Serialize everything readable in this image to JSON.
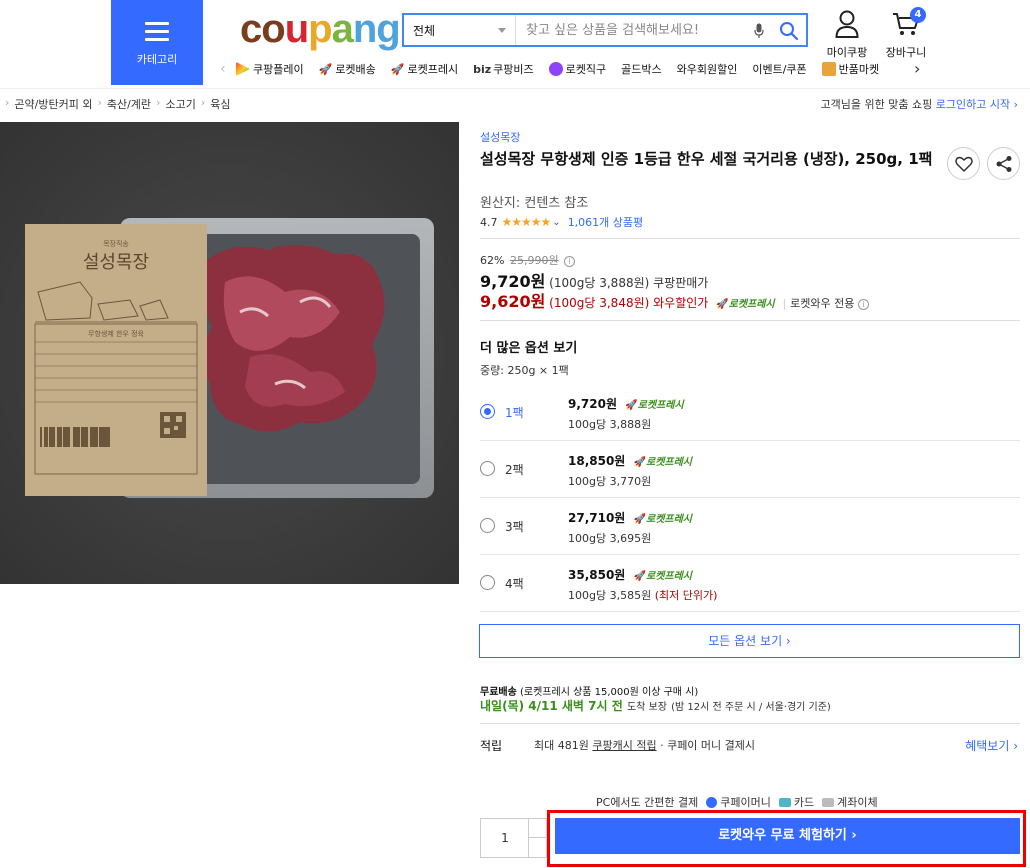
{
  "header": {
    "category_label": "카테고리",
    "logo": [
      "c",
      "o",
      "u",
      "p",
      "a",
      "n",
      "g"
    ],
    "search": {
      "scope": "전체",
      "placeholder": "찾고 싶은 상품을 검색해보세요!"
    },
    "mycoupang_label": "마이쿠팡",
    "cart_label": "장바구니",
    "cart_count": "4"
  },
  "subnav": [
    {
      "label": "쿠팡플레이",
      "icon": "play-icon"
    },
    {
      "label": "로켓배송",
      "icon": "rocket-icon"
    },
    {
      "label": "로켓프레시",
      "icon": "rocket-fresh-icon"
    },
    {
      "prefix": "biz",
      "label": "쿠팡비즈",
      "icon": "biz-icon"
    },
    {
      "label": "로켓직구",
      "icon": "global-icon"
    },
    {
      "label": "골드박스",
      "icon": ""
    },
    {
      "label": "와우회원할인",
      "icon": ""
    },
    {
      "label": "이벤트/쿠폰",
      "icon": ""
    },
    {
      "label": "반품마켓",
      "icon": "return-icon"
    }
  ],
  "breadcrumb": [
    "곤약/방탄커피 외",
    "축산/계란",
    "소고기",
    "육심"
  ],
  "tailored": {
    "text": "고객님을 위한 맞춤 쇼핑",
    "link": "로그인하고 시작 ›"
  },
  "product": {
    "brand": "설성목장",
    "title": "설성목장 무항생제 인증 1등급 한우 세절 국거리용 (냉장), 250g, 1팩",
    "origin": "원산지: 컨텐츠 참조",
    "rating": "4.7",
    "stars": "★★★★★",
    "review_count": "1,061개 상품평",
    "discount_rate": "62%",
    "original_price": "25,990원",
    "price": "9,720원",
    "price_unit": "(100g당 3,888원)",
    "price_label": "쿠팡판매가",
    "wow_price": "9,620원",
    "wow_unit": "(100g당 3,848원)",
    "wow_label": "와우할인가",
    "rocket_fresh": "로켓프레시",
    "wow_only": "로켓와우 전용"
  },
  "options": {
    "heading": "더 많은 옵션 보기",
    "weight": "중량: 250g × 1팩",
    "items": [
      {
        "qty": "1팩",
        "price": "9,720원",
        "unit": "100g당 3,888원",
        "note": "",
        "selected": true
      },
      {
        "qty": "2팩",
        "price": "18,850원",
        "unit": "100g당 3,770원",
        "note": "",
        "selected": false
      },
      {
        "qty": "3팩",
        "price": "27,710원",
        "unit": "100g당 3,695원",
        "note": "",
        "selected": false
      },
      {
        "qty": "4팩",
        "price": "35,850원",
        "unit": "100g당 3,585원",
        "note": "(최저 단위가)",
        "selected": false
      }
    ],
    "all_options": "모든 옵션 보기 ›"
  },
  "shipping": {
    "free_label": "무료배송",
    "free_cond": "(로켓프레시 상품 15,000원 이상 구매 시)",
    "arrival": "내일(목) 4/11 새벽 7시 전",
    "arrival_note": "도착 보장",
    "arrival_cond": "(밤 12시 전 주문 시 / 서울·경기 기준)"
  },
  "points": {
    "label": "적립",
    "prefix": "최대 481원",
    "link": "쿠팡캐시 적립",
    "suffix": " · 쿠페이 머니 결제시",
    "benefit": "혜택보기 ›"
  },
  "payment": {
    "heading": "PC에서도 간편한 결제",
    "methods": [
      {
        "label": "쿠페이머니",
        "color": "#346aff"
      },
      {
        "label": "카드",
        "color": "#4fb6c9"
      },
      {
        "label": "계좌이체",
        "color": "#bbbbbb"
      }
    ]
  },
  "purchase": {
    "quantity": "1",
    "cta": "로켓와우 무료 체험하기 ›"
  },
  "colors": {
    "accent": "#346aff",
    "fresh_green": "#3a8f1b",
    "sale_red": "#ae0000",
    "highlight_frame": "#ee0000"
  }
}
